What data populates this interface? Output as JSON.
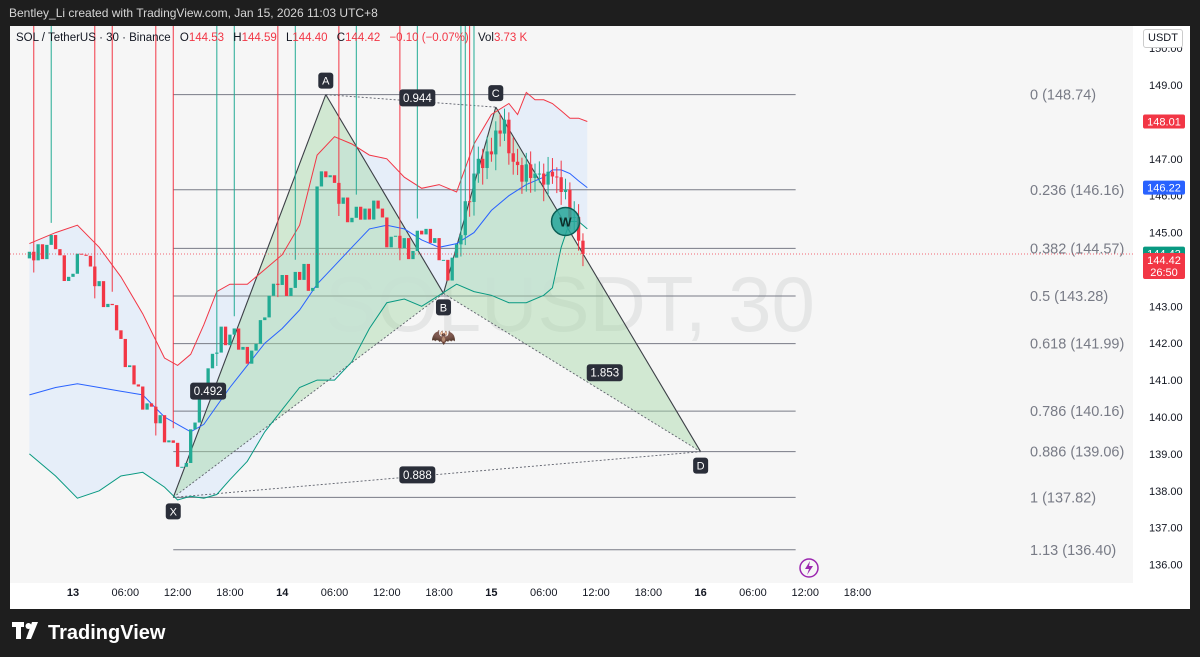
{
  "header": {
    "credit": "Bentley_Li created with TradingView.com, Jan 15, 2026 11:03 UTC+8"
  },
  "legend": {
    "symbol": "SOL / TetherUS · 30 · Binance",
    "o_label": "O",
    "o": "144.53",
    "h_label": "H",
    "h": "144.59",
    "l_label": "L",
    "l": "144.40",
    "c_label": "C",
    "c": "144.42",
    "chg": "−0.10 (−0.07%)",
    "vol_label": "Vol",
    "vol": "3.73 K"
  },
  "currency": "USDT",
  "watermark": "SOLUSDT, 30",
  "brand": "TradingView",
  "colors": {
    "up": "#22ab94",
    "down": "#f23645",
    "pattern": "#a5d6a7",
    "basis": "#2962ff",
    "upper": "#f23645",
    "lower": "#089981",
    "band_fill": "#e3ecf9"
  },
  "chart_data": {
    "type": "candlestick",
    "y_ticks": [
      136.0,
      137.0,
      138.0,
      139.0,
      140.0,
      141.0,
      142.0,
      143.0,
      144.0,
      145.0,
      146.0,
      147.0,
      148.0,
      149.0,
      150.0
    ],
    "y_tick_labels": [
      "136.00",
      "137.00",
      "138.00",
      "139.00",
      "140.00",
      "141.00",
      "142.00",
      "143.00",
      "144.00",
      "145.00",
      "146.00",
      "147.00",
      "148.00",
      "149.00",
      "150.00"
    ],
    "ylim": [
      135.5,
      150.6
    ],
    "x_range_bars": [
      -96,
      102
    ],
    "x_ticks": [
      {
        "bar": -96,
        "label": "13",
        "bold": true
      },
      {
        "bar": -84,
        "label": "06:00"
      },
      {
        "bar": -72,
        "label": "12:00"
      },
      {
        "bar": -60,
        "label": "18:00"
      },
      {
        "bar": -48,
        "label": "14",
        "bold": true
      },
      {
        "bar": -36,
        "label": "06:00"
      },
      {
        "bar": -24,
        "label": "12:00"
      },
      {
        "bar": -12,
        "label": "18:00"
      },
      {
        "bar": 0,
        "label": "15",
        "bold": true
      },
      {
        "bar": 12,
        "label": "06:00"
      },
      {
        "bar": 24,
        "label": "12:00"
      },
      {
        "bar": 36,
        "label": "18:00"
      },
      {
        "bar": 48,
        "label": "16",
        "bold": true
      },
      {
        "bar": 60,
        "label": "06:00"
      },
      {
        "bar": 72,
        "label": "12:00"
      },
      {
        "bar": 84,
        "label": "18:00"
      }
    ],
    "price_close_points": [
      [
        -106,
        144.3
      ],
      [
        -100,
        144.7
      ],
      [
        -97,
        143.6
      ],
      [
        -94,
        144.6
      ],
      [
        -92,
        143.9
      ],
      [
        -89,
        143.2
      ],
      [
        -86,
        142.5
      ],
      [
        -83,
        141.2
      ],
      [
        -80,
        140.4
      ],
      [
        -76,
        139.8
      ],
      [
        -73,
        139.0
      ],
      [
        -71,
        138.6
      ],
      [
        -68,
        139.9
      ],
      [
        -65,
        141.2
      ],
      [
        -62,
        142.2
      ],
      [
        -59,
        142.1
      ],
      [
        -55,
        141.6
      ],
      [
        -52,
        142.9
      ],
      [
        -49,
        143.7
      ],
      [
        -46,
        143.4
      ],
      [
        -43,
        144.1
      ],
      [
        -41,
        143.3
      ],
      [
        -40,
        146.3
      ],
      [
        -38,
        146.7
      ],
      [
        -35,
        145.9
      ],
      [
        -32,
        145.3
      ],
      [
        -29,
        145.6
      ],
      [
        -26,
        145.7
      ],
      [
        -24,
        144.8
      ],
      [
        -21,
        144.7
      ],
      [
        -18,
        144.4
      ],
      [
        -16,
        145.1
      ],
      [
        -14,
        145.0
      ],
      [
        -12,
        144.3
      ],
      [
        -10,
        143.9
      ],
      [
        -8,
        144.5
      ],
      [
        -6,
        145.6
      ],
      [
        -4,
        146.5
      ],
      [
        -2,
        146.9
      ],
      [
        0,
        147.4
      ],
      [
        3,
        147.9
      ],
      [
        5,
        146.8
      ],
      [
        7,
        146.5
      ],
      [
        9,
        146.7
      ],
      [
        11,
        146.3
      ],
      [
        13,
        146.6
      ],
      [
        14,
        146.8
      ],
      [
        15,
        146.3
      ],
      [
        17,
        146.0
      ],
      [
        18,
        145.6
      ],
      [
        19,
        145.3
      ],
      [
        20,
        144.6
      ],
      [
        21,
        144.42
      ]
    ],
    "bollinger": {
      "upper_points": [
        [
          -106,
          144.7
        ],
        [
          -100,
          145.0
        ],
        [
          -95,
          145.2
        ],
        [
          -90,
          144.6
        ],
        [
          -85,
          143.8
        ],
        [
          -80,
          142.8
        ],
        [
          -75,
          141.6
        ],
        [
          -72,
          141.4
        ],
        [
          -69,
          141.7
        ],
        [
          -66,
          142.5
        ],
        [
          -63,
          143.4
        ],
        [
          -60,
          143.6
        ],
        [
          -56,
          143.6
        ],
        [
          -52,
          144.0
        ],
        [
          -48,
          144.4
        ],
        [
          -44,
          145.2
        ],
        [
          -40,
          147.1
        ],
        [
          -36,
          147.6
        ],
        [
          -32,
          147.4
        ],
        [
          -28,
          147.1
        ],
        [
          -24,
          147.0
        ],
        [
          -20,
          146.5
        ],
        [
          -16,
          146.2
        ],
        [
          -12,
          146.3
        ],
        [
          -8,
          146.1
        ],
        [
          -4,
          147.4
        ],
        [
          0,
          148.2
        ],
        [
          4,
          148.5
        ],
        [
          6,
          148.2
        ],
        [
          8,
          148.8
        ],
        [
          10,
          148.6
        ],
        [
          12,
          148.6
        ],
        [
          14,
          148.5
        ],
        [
          16,
          148.3
        ],
        [
          18,
          148.1
        ],
        [
          20,
          148.1
        ],
        [
          22,
          148.01
        ]
      ],
      "basis_points": [
        [
          -106,
          140.6
        ],
        [
          -100,
          140.8
        ],
        [
          -95,
          140.9
        ],
        [
          -90,
          140.8
        ],
        [
          -85,
          140.7
        ],
        [
          -80,
          140.6
        ],
        [
          -75,
          140.0
        ],
        [
          -72,
          139.8
        ],
        [
          -69,
          139.6
        ],
        [
          -66,
          139.8
        ],
        [
          -63,
          140.3
        ],
        [
          -60,
          140.8
        ],
        [
          -56,
          141.4
        ],
        [
          -52,
          142.0
        ],
        [
          -48,
          142.4
        ],
        [
          -44,
          142.9
        ],
        [
          -40,
          143.6
        ],
        [
          -36,
          144.1
        ],
        [
          -32,
          144.6
        ],
        [
          -28,
          145.1
        ],
        [
          -24,
          145.2
        ],
        [
          -20,
          145.1
        ],
        [
          -16,
          144.8
        ],
        [
          -12,
          144.6
        ],
        [
          -8,
          144.7
        ],
        [
          -4,
          145.0
        ],
        [
          0,
          145.6
        ],
        [
          4,
          146.0
        ],
        [
          8,
          146.3
        ],
        [
          12,
          146.5
        ],
        [
          14,
          146.7
        ],
        [
          16,
          146.7
        ],
        [
          18,
          146.6
        ],
        [
          20,
          146.4
        ],
        [
          22,
          146.22
        ]
      ],
      "lower_points": [
        [
          -106,
          139.0
        ],
        [
          -100,
          138.4
        ],
        [
          -95,
          137.8
        ],
        [
          -90,
          138.0
        ],
        [
          -85,
          138.4
        ],
        [
          -80,
          138.5
        ],
        [
          -75,
          138.1
        ],
        [
          -72,
          137.75
        ],
        [
          -69,
          137.85
        ],
        [
          -66,
          137.8
        ],
        [
          -63,
          137.9
        ],
        [
          -60,
          138.3
        ],
        [
          -56,
          138.8
        ],
        [
          -52,
          139.6
        ],
        [
          -48,
          140.2
        ],
        [
          -44,
          140.8
        ],
        [
          -40,
          141.0
        ],
        [
          -36,
          141.0
        ],
        [
          -32,
          141.5
        ],
        [
          -28,
          142.4
        ],
        [
          -24,
          143.1
        ],
        [
          -20,
          143.2
        ],
        [
          -16,
          143.0
        ],
        [
          -12,
          143.3
        ],
        [
          -8,
          143.6
        ],
        [
          -4,
          143.4
        ],
        [
          0,
          143.3
        ],
        [
          4,
          143.1
        ],
        [
          8,
          143.1
        ],
        [
          12,
          143.3
        ],
        [
          14,
          143.5
        ],
        [
          16,
          144.6
        ],
        [
          18,
          145.3
        ],
        [
          20,
          145.3
        ],
        [
          22,
          145.1
        ]
      ]
    },
    "harmonic": {
      "points": [
        {
          "name": "X",
          "bar": -73,
          "price": 137.82
        },
        {
          "name": "A",
          "bar": -38,
          "price": 148.74
        },
        {
          "name": "B",
          "bar": -11,
          "price": 143.35
        },
        {
          "name": "C",
          "bar": 1,
          "price": 148.4
        },
        {
          "name": "D",
          "bar": 48,
          "price": 139.06
        }
      ],
      "ratios": [
        {
          "label": "0.944",
          "bar": -17,
          "price": 148.65
        },
        {
          "label": "0.492",
          "bar": -65,
          "price": 140.7
        },
        {
          "label": "1.853",
          "bar": 26,
          "price": 141.2
        },
        {
          "label": "0.888",
          "bar": -17,
          "price": 138.43
        }
      ]
    },
    "fib_levels": [
      {
        "ratio_label": "0",
        "price": 148.74,
        "label": "0 (148.74)"
      },
      {
        "ratio_label": "0.236",
        "price": 146.16,
        "label": "0.236 (146.16)"
      },
      {
        "ratio_label": "0.382",
        "price": 144.57,
        "label": "0.382 (144.57)"
      },
      {
        "ratio_label": "0.5",
        "price": 143.28,
        "label": "0.5 (143.28)"
      },
      {
        "ratio_label": "0.618",
        "price": 141.99,
        "label": "0.618 (141.99)"
      },
      {
        "ratio_label": "0.786",
        "price": 140.16,
        "label": "0.786 (140.16)"
      },
      {
        "ratio_label": "0.886",
        "price": 139.06,
        "label": "0.886 (139.06)"
      },
      {
        "ratio_label": "1",
        "price": 137.82,
        "label": "1 (137.82)"
      },
      {
        "ratio_label": "1.13",
        "price": 136.4,
        "label": "1.13 (136.40)"
      }
    ],
    "price_labels": [
      {
        "price": 148.01,
        "text": "148.01",
        "color": "#f23645"
      },
      {
        "price": 146.22,
        "text": "146.22",
        "color": "#2962ff"
      },
      {
        "price": 144.43,
        "text": "144.43",
        "color": "#089981"
      },
      {
        "price": 144.42,
        "text": "144.42",
        "sub": "26:50",
        "color": "#f23645"
      }
    ],
    "last_price": 144.42,
    "w_marker": {
      "label": "W",
      "bar": 17,
      "price": 145.3
    }
  }
}
